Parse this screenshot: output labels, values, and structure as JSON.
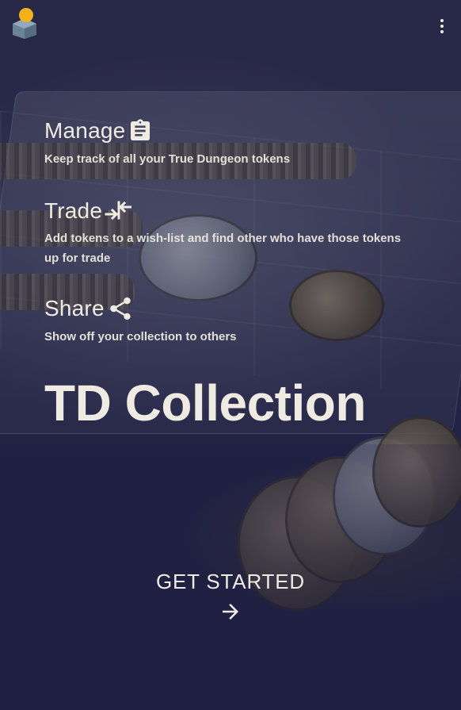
{
  "app": {
    "title": "TD Collection",
    "logo_icon": "cube-token-logo-icon",
    "menu_icon": "more-vert-icon"
  },
  "features": [
    {
      "title": "Manage",
      "icon": "clipboard-icon",
      "description": "Keep track of all your True Dungeon tokens"
    },
    {
      "title": "Trade",
      "icon": "swap-arrows-icon",
      "description": "Add tokens to a wish-list and find other who have those tokens up for trade"
    },
    {
      "title": "Share",
      "icon": "share-icon",
      "description": "Show off your collection to others"
    }
  ],
  "cta": {
    "label": "GET STARTED",
    "icon": "arrow-right-icon"
  },
  "colors": {
    "text": "#f0ebe2",
    "background": "#232447",
    "logo_accent": "#f2b31a",
    "logo_body": "#7d93a6"
  }
}
